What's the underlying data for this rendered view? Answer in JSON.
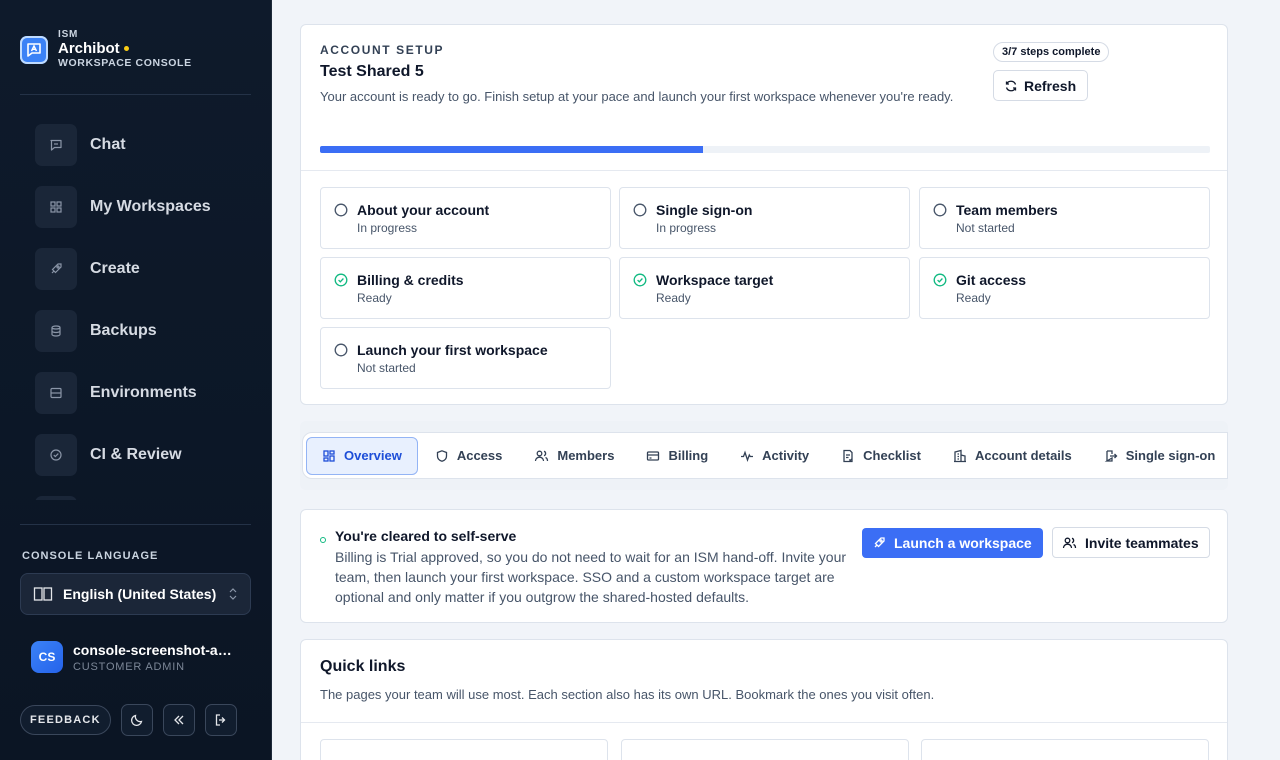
{
  "brand": {
    "kicker": "ISM",
    "name": "Archibot",
    "sub": "WORKSPACE CONSOLE"
  },
  "nav": [
    {
      "label": "Chat",
      "icon": "chat-icon"
    },
    {
      "label": "My Workspaces",
      "icon": "grid-icon"
    },
    {
      "label": "Create",
      "icon": "rocket-icon"
    },
    {
      "label": "Backups",
      "icon": "database-icon"
    },
    {
      "label": "Environments",
      "icon": "server-icon"
    },
    {
      "label": "CI & Review",
      "icon": "check-circle-icon"
    }
  ],
  "language": {
    "title": "CONSOLE LANGUAGE",
    "value": "English (United States)"
  },
  "user": {
    "initials": "CS",
    "name": "console-screenshot-admin",
    "role": "CUSTOMER ADMIN"
  },
  "footer": {
    "feedback": "FEEDBACK"
  },
  "setup": {
    "kicker": "ACCOUNT SETUP",
    "title": "Test Shared 5",
    "description": "Your account is ready to go. Finish setup at your pace and launch your first workspace whenever you're ready.",
    "steps_badge": "3/7 steps complete",
    "refresh_label": "Refresh",
    "progress": 0.43,
    "steps": [
      {
        "title": "About your account",
        "status": "In progress",
        "done": false
      },
      {
        "title": "Single sign-on",
        "status": "In progress",
        "done": false
      },
      {
        "title": "Team members",
        "status": "Not started",
        "done": false
      },
      {
        "title": "Billing & credits",
        "status": "Ready",
        "done": true
      },
      {
        "title": "Workspace target",
        "status": "Ready",
        "done": true
      },
      {
        "title": "Git access",
        "status": "Ready",
        "done": true
      },
      {
        "title": "Launch your first workspace",
        "status": "Not started",
        "done": false
      }
    ]
  },
  "tabs": [
    {
      "label": "Overview",
      "icon": "grid-icon",
      "active": true
    },
    {
      "label": "Access",
      "icon": "shield-icon",
      "active": false
    },
    {
      "label": "Members",
      "icon": "users-icon",
      "active": false
    },
    {
      "label": "Billing",
      "icon": "card-icon",
      "active": false
    },
    {
      "label": "Activity",
      "icon": "pulse-icon",
      "active": false
    },
    {
      "label": "Checklist",
      "icon": "checklist-icon",
      "active": false
    },
    {
      "label": "Account details",
      "icon": "building-icon",
      "active": false
    },
    {
      "label": "Single sign-on",
      "icon": "login-icon",
      "active": false
    }
  ],
  "selfserve": {
    "title": "You're cleared to self-serve",
    "text": "Billing is Trial approved, so you do not need to wait for an ISM hand-off. Invite your team, then launch your first workspace. SSO and a custom workspace target are optional and only matter if you outgrow the shared-hosted defaults.",
    "primary_label": "Launch a workspace",
    "secondary_label": "Invite teammates"
  },
  "quick_links": {
    "title": "Quick links",
    "description": "The pages your team will use most. Each section also has its own URL. Bookmark the ones you visit often."
  },
  "colors": {
    "accent": "#3b6ef5",
    "success": "#10b981",
    "sidebar": "#0e1a2b"
  }
}
